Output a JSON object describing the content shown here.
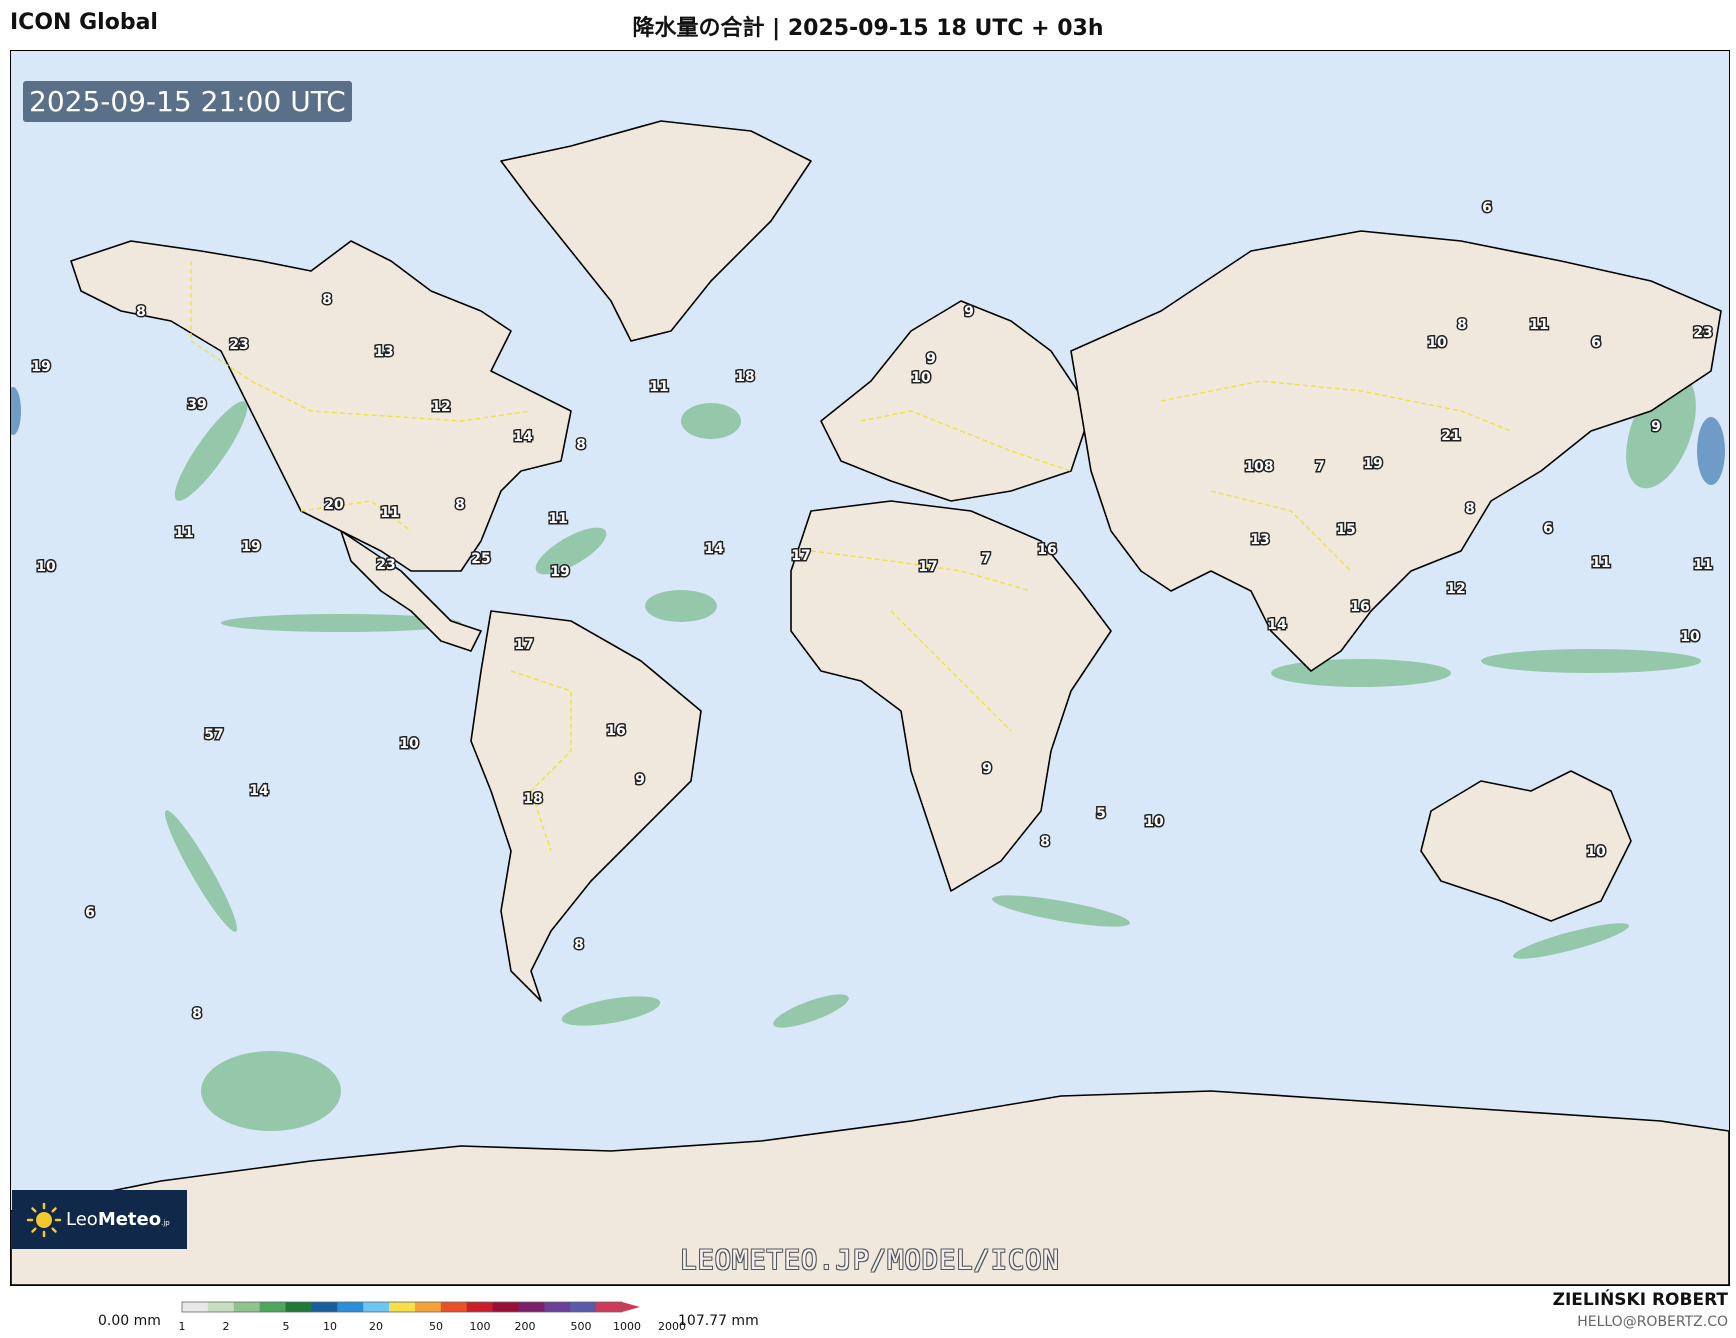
{
  "header": {
    "model": "ICON Global",
    "title": "降水量の合計 | 2025-09-15 18 UTC + 03h"
  },
  "map": {
    "time_badge": "2025-09-15 21:00 UTC",
    "watermark": "LEOMETEO.JP/MODEL/ICON",
    "colors": {
      "ocean": "#d8e8f8",
      "land": "#f0e8dc",
      "precip": "#2e8b4a",
      "borders": "#f0e040"
    },
    "logo": {
      "name": "Leo",
      "bold": "Meteo",
      "suffix": ".jp"
    },
    "labels": [
      {
        "text": "19"
      },
      {
        "text": "8"
      },
      {
        "text": "23"
      },
      {
        "text": "8"
      },
      {
        "text": "13"
      },
      {
        "text": "39"
      },
      {
        "text": "12"
      },
      {
        "text": "14"
      },
      {
        "text": "11"
      },
      {
        "text": "18"
      },
      {
        "text": "8"
      },
      {
        "text": "20"
      },
      {
        "text": "11"
      },
      {
        "text": "8"
      },
      {
        "text": "11"
      },
      {
        "text": "11"
      },
      {
        "text": "19"
      },
      {
        "text": "10"
      },
      {
        "text": "23"
      },
      {
        "text": "25"
      },
      {
        "text": "19"
      },
      {
        "text": "14"
      },
      {
        "text": "17"
      },
      {
        "text": "17"
      },
      {
        "text": "7"
      },
      {
        "text": "16"
      },
      {
        "text": "9"
      },
      {
        "text": "9"
      },
      {
        "text": "10"
      },
      {
        "text": "17"
      },
      {
        "text": "57"
      },
      {
        "text": "10"
      },
      {
        "text": "16"
      },
      {
        "text": "14"
      },
      {
        "text": "9"
      },
      {
        "text": "18"
      },
      {
        "text": "9"
      },
      {
        "text": "5"
      },
      {
        "text": "10"
      },
      {
        "text": "8"
      },
      {
        "text": "6"
      },
      {
        "text": "8"
      },
      {
        "text": "8"
      },
      {
        "text": "6"
      },
      {
        "text": "10"
      },
      {
        "text": "8"
      },
      {
        "text": "11"
      },
      {
        "text": "6"
      },
      {
        "text": "23"
      },
      {
        "text": "9"
      },
      {
        "text": "21"
      },
      {
        "text": "108"
      },
      {
        "text": "7"
      },
      {
        "text": "19"
      },
      {
        "text": "8"
      },
      {
        "text": "6"
      },
      {
        "text": "13"
      },
      {
        "text": "15"
      },
      {
        "text": "11"
      },
      {
        "text": "11"
      },
      {
        "text": "12"
      },
      {
        "text": "16"
      },
      {
        "text": "14"
      },
      {
        "text": "10"
      },
      {
        "text": "10"
      }
    ]
  },
  "legend": {
    "min_label": "0.00 mm",
    "max_label": "107.77 mm",
    "ticks": [
      "1",
      "2",
      "5",
      "10",
      "20",
      "50",
      "100",
      "200",
      "500",
      "1000",
      "2000"
    ],
    "colors": [
      "#e8e8e8",
      "#c8dcc0",
      "#8fc490",
      "#4ea65c",
      "#1f7a3a",
      "#1b5e9e",
      "#2b8fd8",
      "#6cc6f0",
      "#f4e04a",
      "#f6a23a",
      "#e8502a",
      "#c8202a",
      "#9a0f3a",
      "#7a1f6a",
      "#6a3f9a",
      "#5a5aa8",
      "#d03a5a"
    ]
  },
  "credit": {
    "name": "ZIELIŃSKI ROBERT",
    "email": "HELLO@ROBERTZ.CO"
  }
}
